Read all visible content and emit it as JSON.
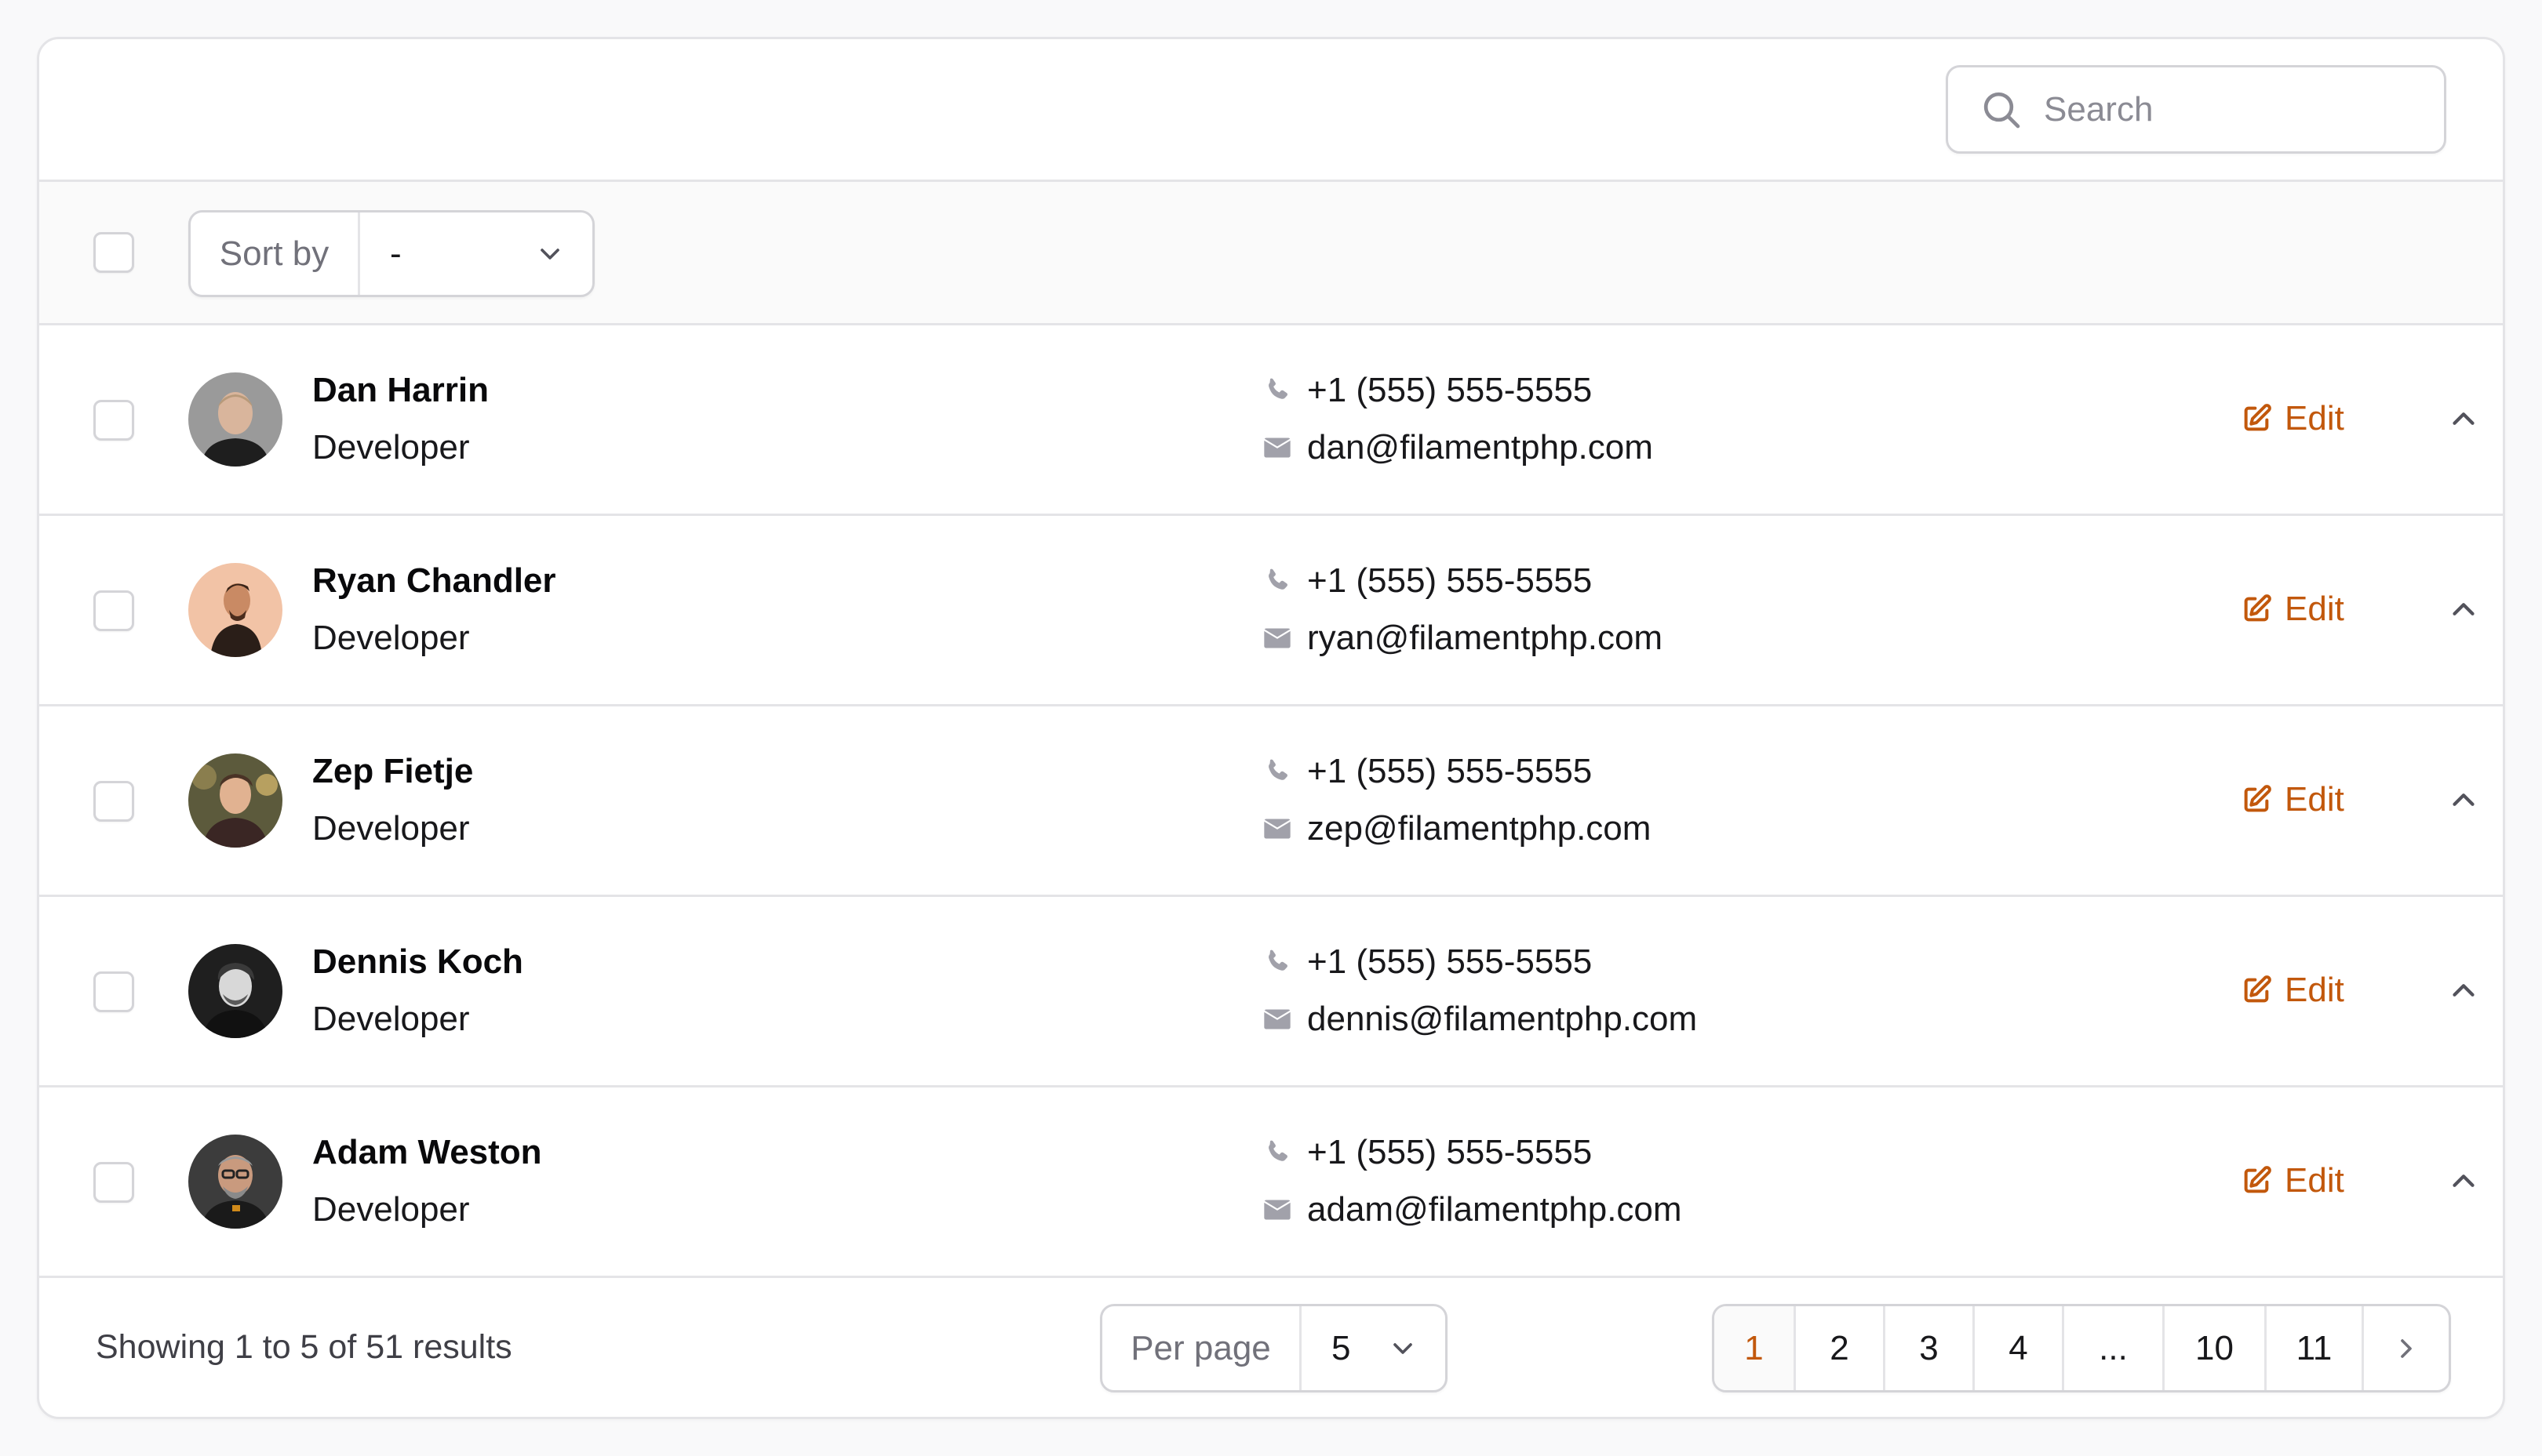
{
  "search": {
    "placeholder": "Search",
    "value": ""
  },
  "toolbar": {
    "sort_label": "Sort by",
    "sort_value": "-"
  },
  "rows": [
    {
      "name": "Dan Harrin",
      "role": "Developer",
      "phone": "+1 (555) 555-5555",
      "email": "dan@filamentphp.com",
      "edit": "Edit"
    },
    {
      "name": "Ryan Chandler",
      "role": "Developer",
      "phone": "+1 (555) 555-5555",
      "email": "ryan@filamentphp.com",
      "edit": "Edit"
    },
    {
      "name": "Zep Fietje",
      "role": "Developer",
      "phone": "+1 (555) 555-5555",
      "email": "zep@filamentphp.com",
      "edit": "Edit"
    },
    {
      "name": "Dennis Koch",
      "role": "Developer",
      "phone": "+1 (555) 555-5555",
      "email": "dennis@filamentphp.com",
      "edit": "Edit"
    },
    {
      "name": "Adam Weston",
      "role": "Developer",
      "phone": "+1 (555) 555-5555",
      "email": "adam@filamentphp.com",
      "edit": "Edit"
    }
  ],
  "footer": {
    "results": "Showing 1 to 5 of 51 results",
    "per_page_label": "Per page",
    "per_page_value": "5",
    "pages": [
      "1",
      "2",
      "3",
      "4",
      "...",
      "10",
      "11"
    ],
    "active_page": "1"
  },
  "colors": {
    "accent": "#c2580c",
    "border": "#e4e4e7",
    "muted": "#71717a"
  },
  "icons": [
    "search-icon",
    "chevron-down-icon",
    "phone-icon",
    "envelope-icon",
    "pencil-square-icon",
    "chevron-up-icon",
    "chevron-right-icon"
  ]
}
